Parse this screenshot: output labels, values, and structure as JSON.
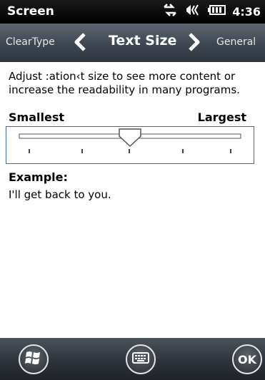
{
  "statusbar": {
    "title": "Screen",
    "time": "4:36",
    "icons": [
      "data-connection-icon",
      "speaker-icon",
      "battery-icon"
    ]
  },
  "nav": {
    "prev_label": "ClearType",
    "title": "Text Size",
    "next_label": "General"
  },
  "content": {
    "description": "Adjust :ation‹t size to see more content or increase the readability in many programs.",
    "smallest_label": "Smallest",
    "largest_label": "Largest",
    "slider": {
      "positions": 5,
      "selected_index": 2
    },
    "example_label": "Example:",
    "example_text": "I'll get back to you."
  },
  "bottombar": {
    "ok_label": "OK",
    "icons": [
      "windows-start-icon",
      "keyboard-icon"
    ]
  },
  "colors": {
    "statusbar_bg": "#000000",
    "navbar_bg": "#3b434e",
    "slider_border": "#3e6ab5"
  }
}
